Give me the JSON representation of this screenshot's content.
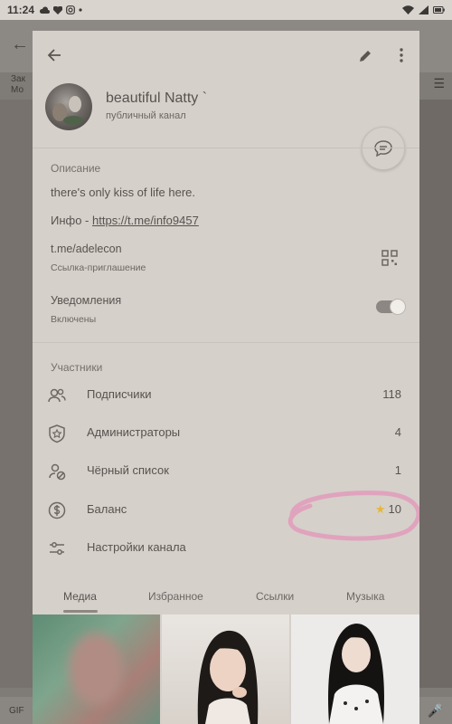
{
  "status_bar": {
    "time": "11:24",
    "left_icons": [
      "cloud-icon",
      "heart-icon",
      "instagram-icon",
      "dot-icon"
    ],
    "right_icons": [
      "wifi-icon",
      "signal-icon",
      "battery-icon"
    ]
  },
  "background": {
    "tag_line1": "Зак",
    "tag_line2": "Мо"
  },
  "header": {
    "back_icon": "arrow-left-icon",
    "edit_icon": "pencil-icon",
    "more_icon": "more-vertical-icon"
  },
  "channel": {
    "name": "beautiful Natty `",
    "type": "публичный канал"
  },
  "description_section": {
    "heading": "Описание",
    "text": "there's only kiss of life here.",
    "info_prefix": "Инфо  - ",
    "info_link": "https://t.me/info9457"
  },
  "invite": {
    "link": "t.me/adelecon",
    "label": "Ссылка-приглашение"
  },
  "notifications": {
    "label": "Уведомления",
    "state": "Включены",
    "enabled": true
  },
  "members": {
    "heading": "Участники",
    "rows": [
      {
        "label": "Подписчики",
        "count": "118",
        "icon": "users-icon"
      },
      {
        "label": "Администраторы",
        "count": "4",
        "icon": "shield-star-icon"
      },
      {
        "label": "Чёрный список",
        "count": "1",
        "icon": "user-block-icon"
      },
      {
        "label": "Баланс",
        "count": "10",
        "icon": "dollar-coin-icon",
        "badge": "star-icon"
      },
      {
        "label": "Настройки канала",
        "count": "",
        "icon": "sliders-icon"
      }
    ]
  },
  "annotation": {
    "color": "#e0a3bd"
  },
  "tabs": [
    {
      "label": "Медиа",
      "active": true
    },
    {
      "label": "Избранное",
      "active": false
    },
    {
      "label": "Ссылки",
      "active": false
    },
    {
      "label": "Музыка",
      "active": false
    }
  ],
  "colors": {
    "panel": "#d6d0ca",
    "text": "#57534f",
    "muted": "#75706b",
    "star": "#e4b73a"
  }
}
